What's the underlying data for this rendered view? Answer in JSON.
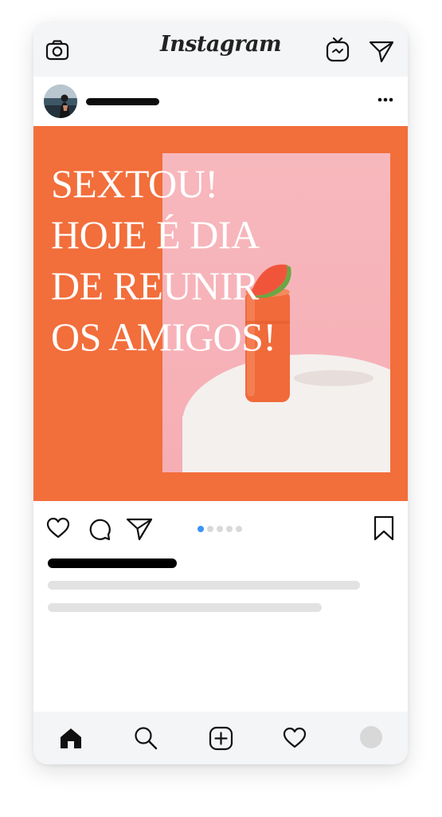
{
  "app": {
    "brand": "Instagram"
  },
  "top_icons": [
    "camera-icon",
    "igtv-icon",
    "direct-message-icon"
  ],
  "post": {
    "more_icon": "more-dots-icon",
    "headline_lines": [
      "SEXTOU!",
      "HOJE É DIA",
      "DE REUNIR",
      "OS AMIGOS!"
    ],
    "colors": {
      "background": "#f26e3b",
      "photo": "#f6b2b8"
    }
  },
  "carousel": {
    "total": 5,
    "active": 1
  },
  "action_icons": [
    "heart-icon",
    "comment-icon",
    "share-icon",
    "bookmark-icon"
  ],
  "bottom_nav": [
    "home-icon",
    "search-icon",
    "add-post-icon",
    "activity-heart-icon",
    "profile-avatar"
  ]
}
